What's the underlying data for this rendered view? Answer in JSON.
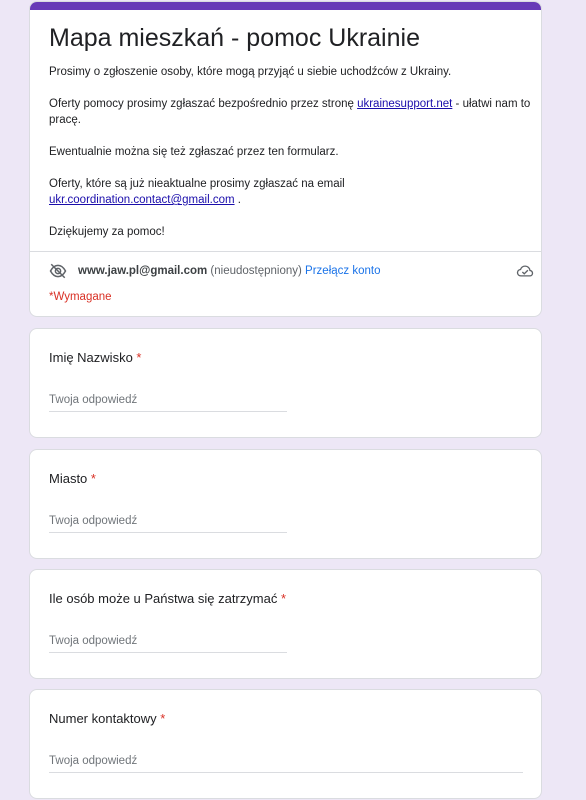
{
  "header": {
    "title": "Mapa mieszkań - pomoc Ukrainie",
    "paragraph1": "Prosimy o zgłoszenie osoby, które mogą przyjąć u siebie uchodźców z Ukrainy.",
    "paragraph2_before": "Oferty pomocy prosimy zgłaszać bezpośrednio przez stronę ",
    "paragraph2_link": "ukrainesupport.net",
    "paragraph2_after": " - ułatwi nam to pracę.",
    "paragraph3": "Ewentualnie można się też zgłaszać przez ten formularz.",
    "paragraph4_before": "Oferty, które są już nieaktualne prosimy zgłaszać na email ",
    "paragraph4_link": "ukr.coordination.contact@gmail.com",
    "paragraph4_after": " .",
    "paragraph5": "Dziękujemy za pomoc!"
  },
  "account": {
    "email": "www.jaw.pl@gmail.com",
    "note": "(nieudostępniony)",
    "switch_label": "Przełącz konto",
    "hidden_icon": "visibility-off-icon",
    "cloud_icon": "cloud-done-icon"
  },
  "required_note": "*Wymagane",
  "questions": [
    {
      "label": "Imię Nazwisko",
      "required_mark": "*",
      "placeholder": "Twoja odpowiedź"
    },
    {
      "label": "Miasto",
      "required_mark": "*",
      "placeholder": "Twoja odpowiedź"
    },
    {
      "label": "Ile osób może u Państwa się zatrzymać",
      "required_mark": "*",
      "placeholder": "Twoja odpowiedź"
    },
    {
      "label": "Numer kontaktowy",
      "required_mark": "*",
      "placeholder": "Twoja odpowiedź"
    }
  ],
  "colors": {
    "accent": "#673ab7",
    "background": "#ede7f6",
    "required": "#d93025",
    "link": "#1a0dab",
    "switch_link": "#1a73e8"
  }
}
